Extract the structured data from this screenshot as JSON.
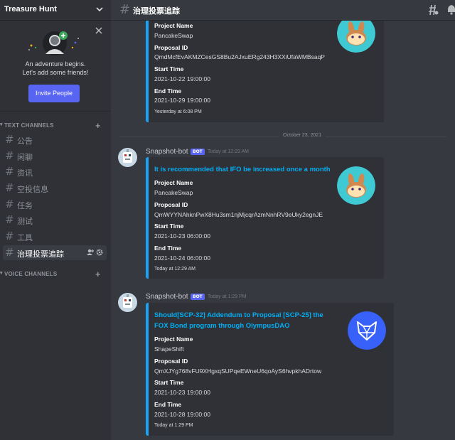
{
  "server": {
    "name": "Treasure Hunt"
  },
  "invite": {
    "line1": "An adventure begins.",
    "line2": "Let's add some friends!",
    "button": "Invite People"
  },
  "categories": {
    "text": "TEXT CHANNELS",
    "voice": "VOICE CHANNELS"
  },
  "channels": [
    {
      "name": "公告"
    },
    {
      "name": "闲聊"
    },
    {
      "name": "资讯"
    },
    {
      "name": "空投信息"
    },
    {
      "name": "任务"
    },
    {
      "name": "测试"
    },
    {
      "name": "工具"
    },
    {
      "name": "治理投票追踪",
      "active": true
    }
  ],
  "header": {
    "channel": "治理投票追踪"
  },
  "labels": {
    "project": "Project Name",
    "proposal": "Proposal ID",
    "start": "Start Time",
    "end": "End Time"
  },
  "date_divider": "October 23, 2021",
  "messages": [
    {
      "embed": {
        "project": "PancakeSwap",
        "proposal": "QmdMcfEvAKMZCesGS8Bu2AJxuERg243H3XXiUfaWMBsaqP",
        "start": "2021-10-22 19:00:00",
        "end": "2021-10-29 19:00:00",
        "footer": "Yesterday at 6:08 PM"
      }
    },
    {
      "author": "Snapshot-bot",
      "tag": "BOT",
      "timestamp": "Today at 12:29 AM",
      "embed": {
        "title": "It is recommended that IFO be increased once a month",
        "project": "PancakeSwap",
        "proposal": "QmWYYNAhknPwX8Hu3sm1njMjcqrAzmNnhRV9eUky2egnJE",
        "start": "2021-10-23 06:00:00",
        "end": "2021-10-24 06:00:00",
        "footer": "Today at 12:29 AM"
      }
    },
    {
      "author": "Snapshot-bot",
      "tag": "BOT",
      "timestamp": "Today at 1:29 PM",
      "embed": {
        "title_line1": "Should[SCP-32] Addendum to Proposal [SCP-25] the",
        "title_line2": "FOX Bond program through OlympusDAO",
        "project": "ShapeShift",
        "proposal": "QmXJYg768vFU9XHgxqSUPqeEWneU6qoAyS6hvpkhADrtow",
        "start": "2021-10-23 19:00:00",
        "end": "2021-10-28 19:00:00",
        "footer": "Today at 1:29 PM"
      }
    }
  ],
  "colors": {
    "embed_border": "#1da1f2",
    "title_link": "#00aff4",
    "invite_button": "#5865f2",
    "pancake_bg": "#3ec9d3",
    "shapeshift_bg": "#3761f9"
  }
}
